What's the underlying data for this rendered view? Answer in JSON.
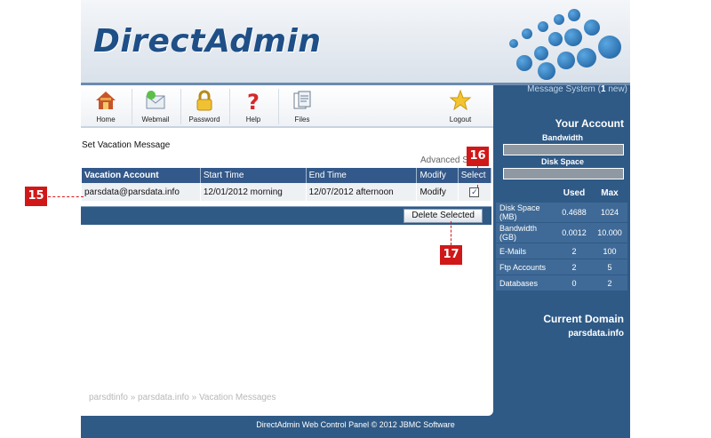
{
  "app": {
    "logo": "DirectAdmin"
  },
  "message_system": {
    "label": "Message System (",
    "count": "1",
    "suffix": " new)"
  },
  "toolbar": {
    "items": [
      {
        "label": "Home",
        "icon": "house-icon"
      },
      {
        "label": "Webmail",
        "icon": "mail-icon"
      },
      {
        "label": "Password",
        "icon": "lock-icon"
      },
      {
        "label": "Help",
        "icon": "question-icon"
      },
      {
        "label": "Files",
        "icon": "files-icon"
      }
    ],
    "logout": {
      "label": "Logout",
      "icon": "star-icon"
    }
  },
  "main": {
    "title": "Set Vacation Message",
    "advanced_link": "Advanced S",
    "table": {
      "headers": [
        "Vacation Account",
        "Start Time",
        "End Time",
        "Modify",
        "Select"
      ],
      "rows": [
        {
          "account": "parsdata@parsdata.info",
          "start": "12/01/2012 morning",
          "end": "12/07/2012 afternoon",
          "modify": "Modify",
          "selected": true
        }
      ]
    },
    "delete_button": "Delete Selected",
    "breadcrumb": "parsdtinfo » parsdata.info » Vacation Messages"
  },
  "account": {
    "title": "Your Account",
    "bandwidth_label": "Bandwidth",
    "disk_label": "Disk Space",
    "stats_headers": [
      "Used",
      "Max"
    ],
    "stats": [
      {
        "label": "Disk Space (MB)",
        "used": "0.4688",
        "max": "1024"
      },
      {
        "label": "Bandwidth (GB)",
        "used": "0.0012",
        "max": "10.000"
      },
      {
        "label": "E-Mails",
        "used": "2",
        "max": "100"
      },
      {
        "label": "Ftp Accounts",
        "used": "2",
        "max": "5"
      },
      {
        "label": "Databases",
        "used": "0",
        "max": "2"
      }
    ],
    "domain_title": "Current Domain",
    "domain": "parsdata.info"
  },
  "footer": "DirectAdmin Web Control Panel © 2012 JBMC Software",
  "annotations": {
    "m15": "15",
    "m16": "16",
    "m17": "17",
    "color": "#d01818"
  }
}
